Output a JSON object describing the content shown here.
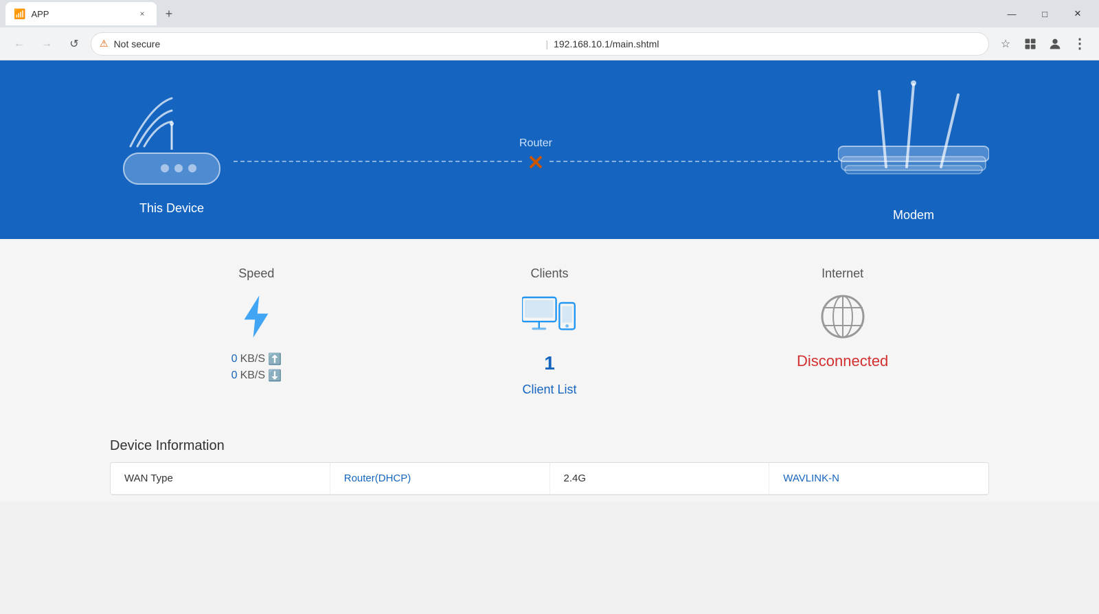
{
  "browser": {
    "tab_title": "APP",
    "close_tab_label": "×",
    "new_tab_label": "+",
    "win_minimize": "—",
    "win_maximize": "□",
    "win_close": "✕",
    "back_btn": "←",
    "forward_btn": "→",
    "refresh_btn": "↺",
    "security_warning": "⚠",
    "address": "192.168.10.1/main.shtml",
    "not_secure_label": "Not secure",
    "star_icon": "☆",
    "extensions_icon": "🧩",
    "profile_icon": "👤",
    "menu_icon": "⋮"
  },
  "hero": {
    "device_label": "This Device",
    "modem_label": "Modem",
    "router_label": "Router",
    "connection_status": "disconnected"
  },
  "stats": {
    "speed_title": "Speed",
    "upload_value": "0",
    "upload_unit": "KB/S",
    "download_value": "0",
    "download_unit": "KB/S",
    "clients_title": "Clients",
    "clients_count": "1",
    "client_list_label": "Client List",
    "internet_title": "Internet",
    "internet_status": "Disconnected"
  },
  "device_info": {
    "section_title": "Device Information",
    "wan_type_label": "WAN Type",
    "wan_type_value": "Router(DHCP)",
    "band_label": "2.4G",
    "ssid_value": "WAVLINK-N"
  }
}
